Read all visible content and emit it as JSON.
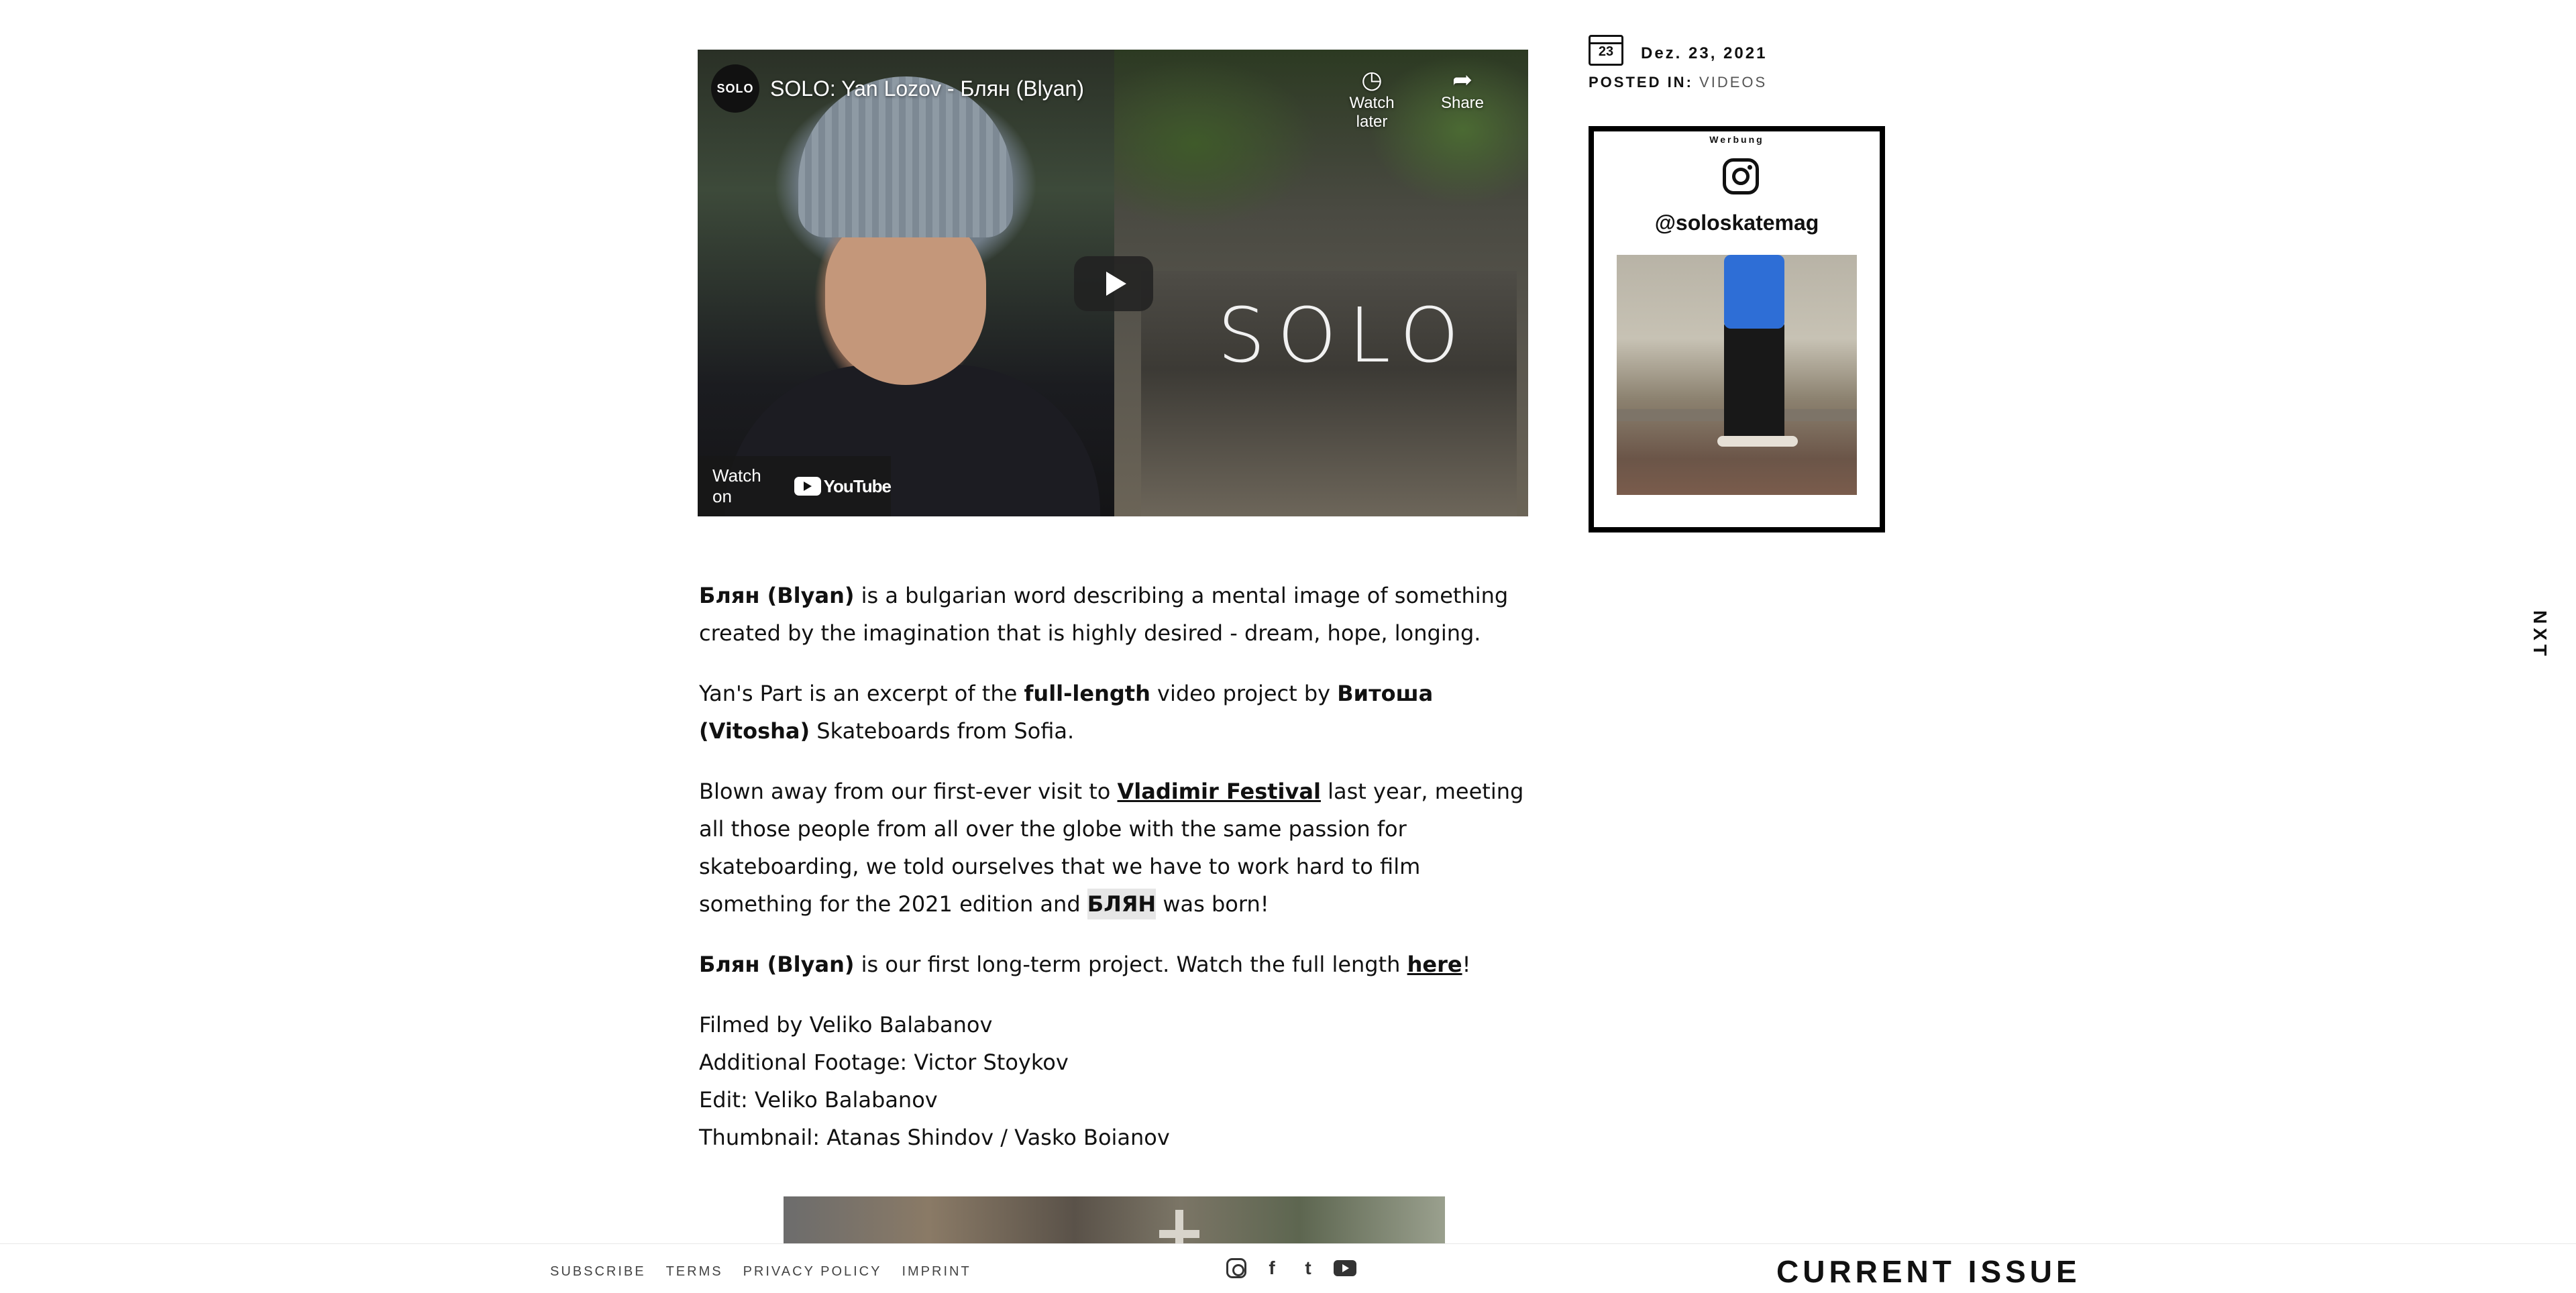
{
  "video": {
    "channel_badge": "SOLO",
    "title": "SOLO: Yan Lozov - Блян (Blyan)",
    "watch_later": "Watch later",
    "share": "Share",
    "watch_on": "Watch on",
    "youtube": "YouTube",
    "overlay_logo": "SOLO"
  },
  "article": {
    "p1": {
      "bold": "Блян (Blyan)",
      "rest": " is a bulgarian word describing a mental image of something created by the imagination that is highly desired - dream, hope, longing."
    },
    "p2": {
      "pre": "Yan's Part is an excerpt of the ",
      "bold1": "full-length",
      "mid": " video project by ",
      "bold2": "Витоша (Vitosha)",
      "post": " Skateboards from Sofia."
    },
    "p3": {
      "pre": "Blown away from our first-ever visit to ",
      "link": "Vladimir Festival",
      "mid": " last year, meeting all those people from all over the globe with the same passion for skateboarding, we told ourselves that we have to work hard to film something for the 2021 edition and ",
      "highlight": "БЛЯН",
      "post": " was born!"
    },
    "p4": {
      "bold": "Блян (Blyan)",
      "mid": " is our first long-term project. Watch the full length ",
      "link": "here",
      "post": "!"
    },
    "credits": [
      "Filmed by Veliko Balabanov",
      "Additional Footage: Victor Stoykov",
      "Edit: Veliko Balabanov",
      "Thumbnail: Atanas Shindov / Vasko Boianov"
    ]
  },
  "sidebar": {
    "calendar_day": "23",
    "date": "Dez. 23, 2021",
    "posted_in_label": "POSTED IN:",
    "category": "VIDEOS",
    "ad_label": "Werbung",
    "instagram_handle": "@soloskatemag"
  },
  "nav": {
    "next": "NXT"
  },
  "footer": {
    "links": [
      "SUBSCRIBE",
      "TERMS",
      "PRIVACY POLICY",
      "IMPRINT"
    ],
    "social": {
      "facebook": "f",
      "tumblr": "t"
    },
    "current_issue": "CURRENT ISSUE"
  }
}
